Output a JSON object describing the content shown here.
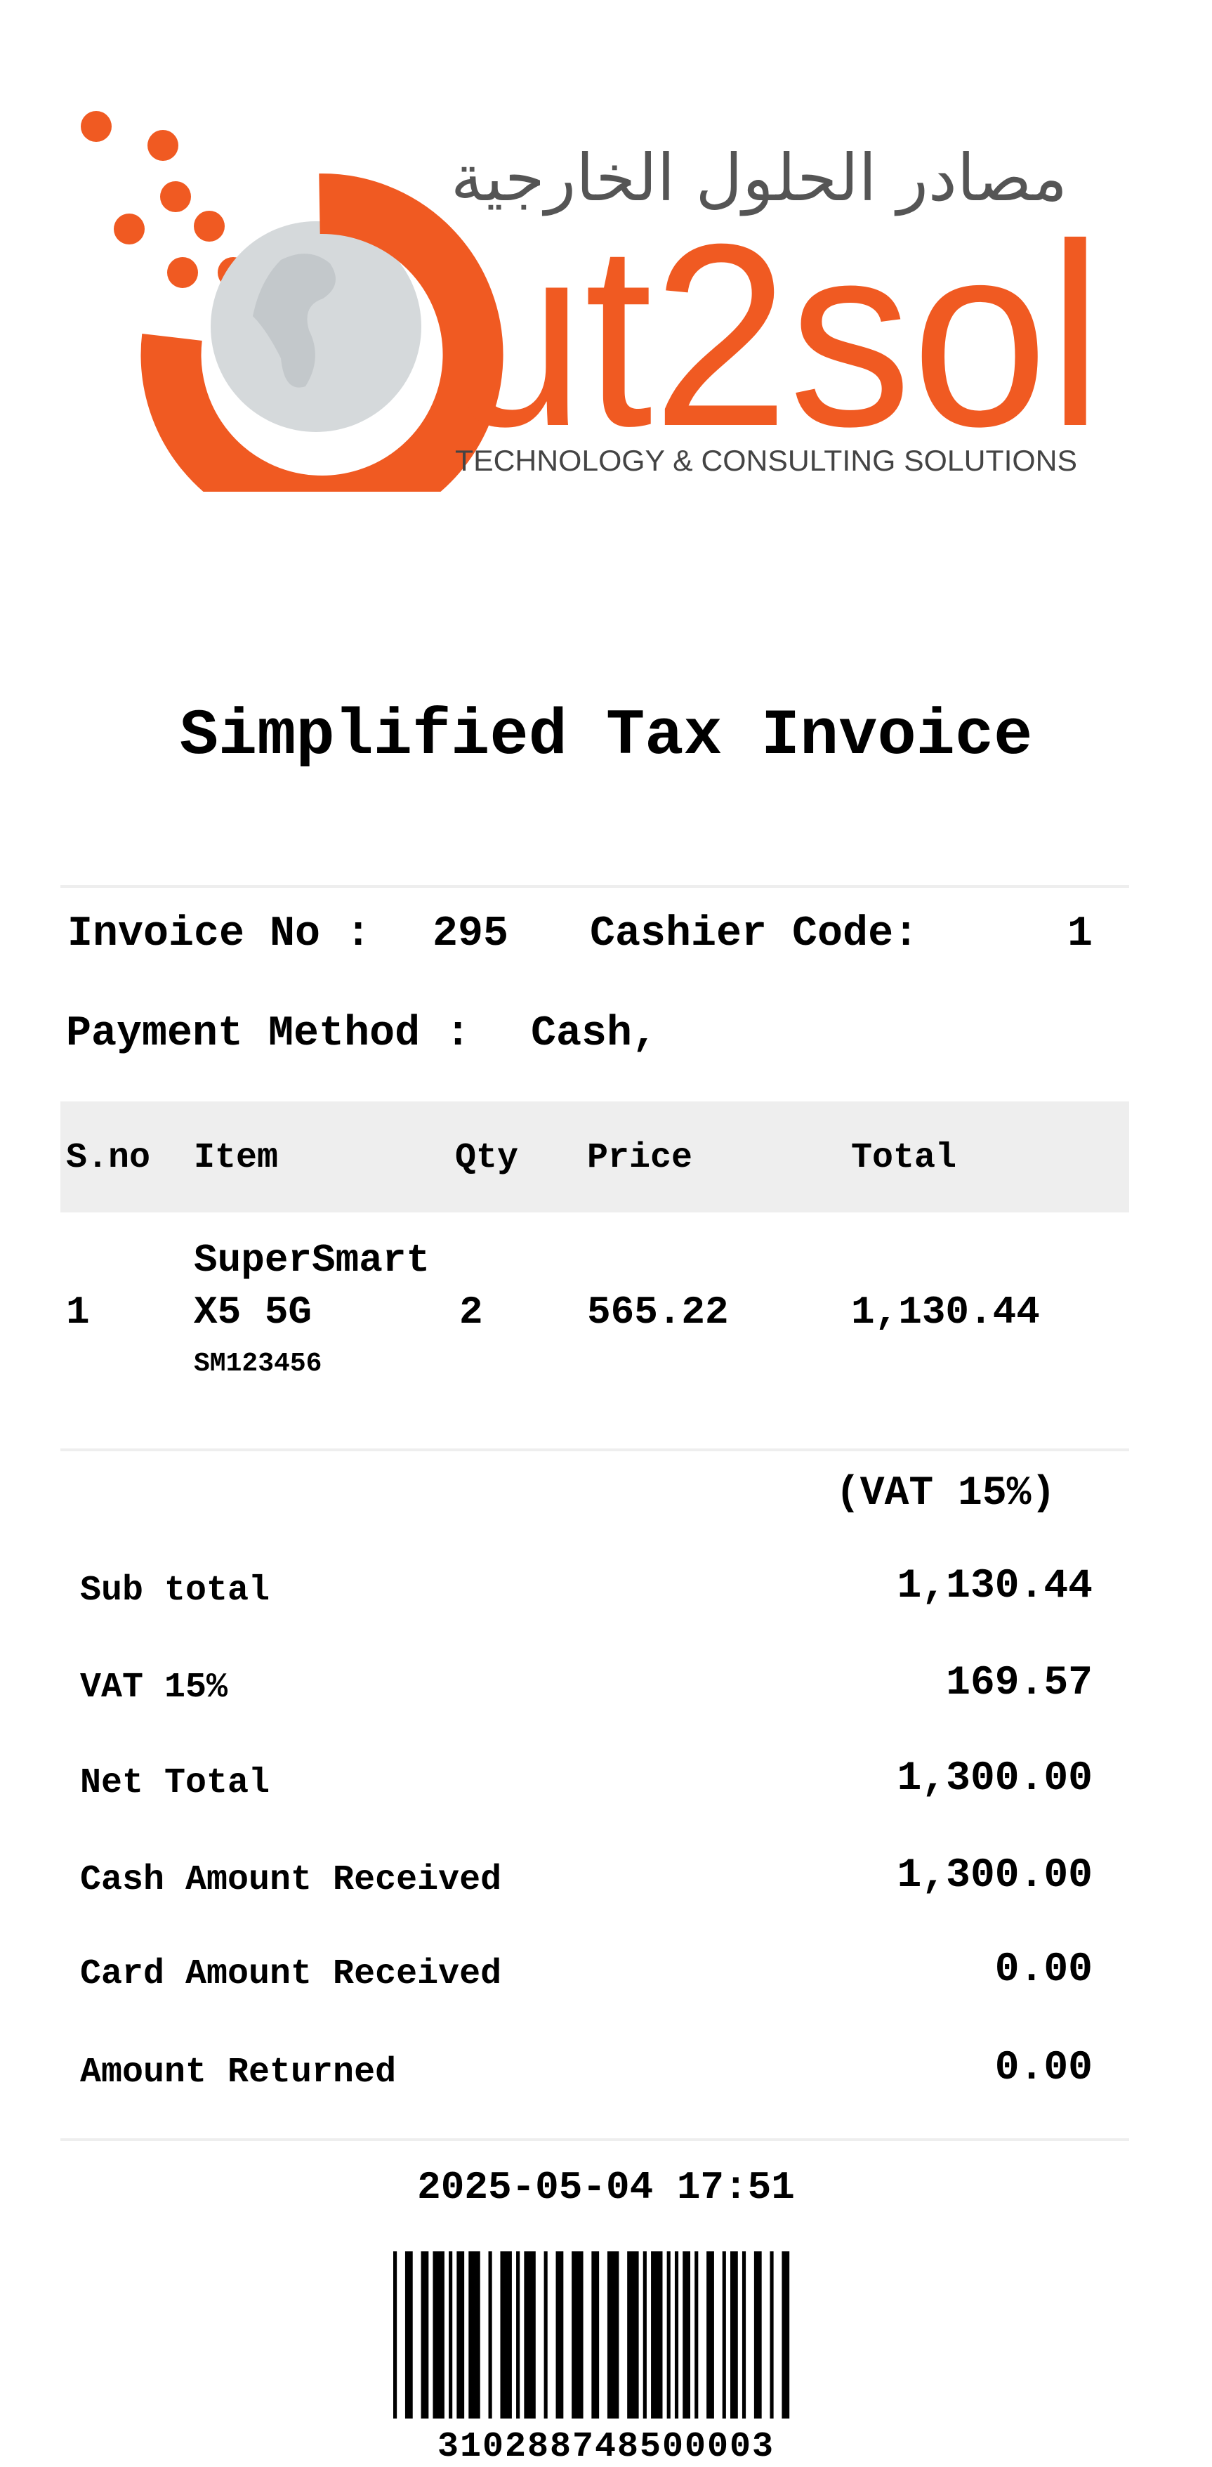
{
  "logo": {
    "arabic_text": "مصادر الحلول الخارجية",
    "brand_text": "ut2sol",
    "tagline": "TECHNOLOGY & CONSULTING SOLUTIONS",
    "brand_color": "#f05a22",
    "globe_color": "#d5d9db",
    "arabic_color": "#555555",
    "tagline_color": "#444444",
    "icon": "globe-icon"
  },
  "title": "Simplified Tax Invoice",
  "invoice": {
    "no_label": "Invoice No :",
    "no_value": "295",
    "cashier_label": "Cashier Code:",
    "cashier_value": "1",
    "payment_label": "Payment Method :",
    "payment_value": "Cash,"
  },
  "table": {
    "headers": [
      "S.no",
      "Item",
      "Qty",
      "Price",
      "Total"
    ],
    "rows": [
      {
        "sno": "1",
        "item_line1": "SuperSmart",
        "item_line2": "X5 5G",
        "item_code": "SM123456",
        "qty": "2",
        "price": "565.22",
        "total": "1,130.44"
      }
    ]
  },
  "vat_note": "(VAT 15%)",
  "totals": [
    {
      "label": "Sub total",
      "value": "1,130.44"
    },
    {
      "label": "VAT 15%",
      "value": "169.57"
    },
    {
      "label": "Net Total",
      "value": "1,300.00"
    },
    {
      "label": "Cash Amount Received",
      "value": "1,300.00"
    },
    {
      "label": "Card Amount Received",
      "value": "0.00"
    },
    {
      "label": "Amount Returned",
      "value": "0.00"
    }
  ],
  "datetime": "2025-05-04 17:51",
  "barcode_number": "310288748500003"
}
